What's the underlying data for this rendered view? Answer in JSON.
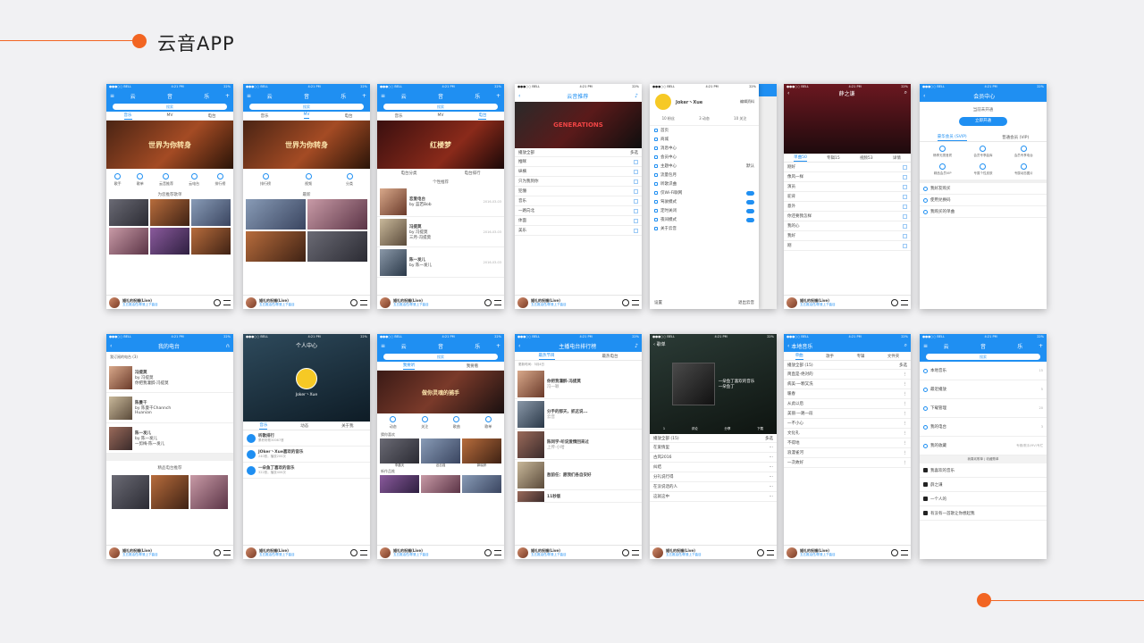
{
  "header": {
    "title": "云音APP"
  },
  "common": {
    "status": {
      "carrier": "●●●○○ BELL",
      "time": "4:21 PM",
      "battery": "22%"
    },
    "player": {
      "song": "婚礼的祝福(Live)",
      "artist": "五五推活任/陈曼上下曲目"
    },
    "search_placeholder": "搜索",
    "nav_tabs": [
      "云",
      "音",
      "乐"
    ],
    "sub_tabs": [
      "音乐",
      "MV",
      "电台"
    ]
  },
  "row1": {
    "p1": {
      "banner": "世界为你转身",
      "icons": [
        "歌手",
        "歌单",
        "云音推荐",
        "云电台",
        "排行榜"
      ],
      "section": "为您推荐歌单"
    },
    "p2": {
      "banner": "世界为你转身",
      "icons": [
        "排行榜",
        "视频",
        "分类"
      ],
      "section": "最新"
    },
    "p3": {
      "banner": "红楼梦",
      "icons": [
        "电台分类",
        "电台排行"
      ],
      "section": "个性推荐",
      "items": [
        {
          "title": "恋爱电台",
          "sub": "by 蓝若Bob",
          "date": "2016-03-03"
        },
        {
          "title": "冯提莫",
          "sub": "by 冯提莫",
          "date": "2016-03-03"
        },
        {
          "title": "三月-冯提莫",
          "sub": "",
          "date": ""
        },
        {
          "title": "陈一发儿",
          "sub": "by 陈一发儿",
          "date": "2016-03-03"
        }
      ]
    },
    "p4": {
      "title": "云音推荐",
      "banner": "GENERATIONS",
      "play_all": "播放全部",
      "multi": "多选",
      "songs": [
        "推眯",
        "纵横",
        "只为我到你",
        "犯懵",
        "音乐",
        "一路向北",
        "体面",
        "美乐"
      ]
    },
    "p5": {
      "user": "Joker丶Xue",
      "edit": "编辑资料",
      "stats": [
        "10 粉丝",
        "3 动态",
        "10 关注"
      ],
      "menu": [
        "首页",
        "商城",
        "消息中心",
        "会员中心",
        "主题中心",
        "流量包月",
        "听歌识曲",
        "仅Wi-Fi联网",
        "驾驶模式",
        "定时关闭",
        "夜间模式",
        "关于云音"
      ],
      "footer_left": "设置",
      "footer_right": "退出云音",
      "theme_value": "默认"
    },
    "p6": {
      "title": "薛之谦",
      "tabs": [
        "单曲50",
        "专辑15",
        "视频53",
        "详情"
      ],
      "songs": [
        "刚好",
        "像风一样",
        "演员",
        "驼背",
        "意外",
        "你还要我怎样",
        "我的心",
        "我好",
        "刚"
      ]
    },
    "p7": {
      "title": "会员中心",
      "status": "当前未开通",
      "button": "立即开通",
      "tabs": [
        "豪华会员 (SVIP)",
        "普通会员 (VIP)"
      ],
      "perks": [
        "畅享无损音质",
        "会员专享曲库",
        "会员专享电台",
        "精品会员VIP",
        "专属个性皮肤",
        "专属动态图片"
      ],
      "links": [
        "我好友购买",
        "使用兑换码",
        "我购买的单曲"
      ]
    }
  },
  "row2": {
    "q1": {
      "title": "我的电台",
      "sub": "我订阅的电台 (3)",
      "items": [
        {
          "title": "冯提莫",
          "sub": "by 冯提莫",
          "sub2": "你把我灌醉-冯提莫"
        },
        {
          "title": "陈曼千",
          "sub": "by 陈曼千Channch",
          "sub2": "Huanian"
        },
        {
          "title": "陈一发儿",
          "sub": "by 陈一发儿",
          "sub2": "一剪梅-陈一发儿"
        }
      ],
      "section": "精品电台推荐"
    },
    "q2": {
      "title": "个人中心",
      "user": "Joker丶Xue",
      "tabs": [
        "音乐",
        "动态",
        "关于我"
      ],
      "items": [
        {
          "title": "听歌排行",
          "sub": "累积听歌30067首"
        },
        {
          "title": "JOker丶Xue喜欢的音乐",
          "sub": "240首，播放200次"
        },
        {
          "title": "一朵鱼丁喜欢的音乐",
          "sub": "322首，播放40K次"
        }
      ]
    },
    "q3": {
      "tabs": [
        "我要听",
        "我要看"
      ],
      "banner": "做你灵魂的捕手",
      "icons": [
        "动态",
        "关注",
        "歌曲",
        "歌单"
      ],
      "section1": "猜你喜欢",
      "labels": [
        "李晨天",
        "迟志强",
        "郭晓婷"
      ],
      "section2": "新作品推"
    },
    "q4": {
      "title": "主播电台排行榜",
      "tabs": [
        "最热节目",
        "最热电台"
      ],
      "date": "更新时间：3月4日",
      "items": [
        {
          "title": "你把我灌醉-冯提莫",
          "sub": "冯一颖"
        },
        {
          "title": "分手的那天，抓这说...",
          "sub": "云音"
        },
        {
          "title": "陈同学-听说爱情回来过",
          "sub": "上传-小哈"
        },
        {
          "title": "敖前任：愿我们各自安好",
          "sub": ""
        },
        {
          "title": "11秒版",
          "sub": ""
        }
      ]
    },
    "q5": {
      "back": "歌单",
      "title": "一朵鱼丁喜欢的音乐",
      "owner": "一朵鱼丁",
      "actions": [
        "1",
        "评论",
        "分享",
        "下载"
      ],
      "play_all": "播放全部 (15)",
      "multi": "多选",
      "songs": [
        "在爱情里",
        "古风2016",
        "纠结",
        "分礼说行得",
        "在没说话的人",
        "这就这中"
      ]
    },
    "q6": {
      "title": "本地音乐",
      "tabs": [
        "单曲",
        "歌手",
        "专辑",
        "文件夹"
      ],
      "play_all": "播放全部 (15)",
      "multi": "多选",
      "songs": [
        "简直是-绝对的",
        "病美-一颗又洗",
        "暖春",
        "从此以后",
        "美丽-一路一段",
        "一不小心",
        "文化礼",
        "不得地",
        "浪漫雀河",
        "一次故好"
      ]
    },
    "q7": {
      "menu": [
        {
          "label": "本地音乐",
          "count": "15"
        },
        {
          "label": "最近播放",
          "count": "5"
        },
        {
          "label": "下载管理",
          "count": "20"
        },
        {
          "label": "我的电台",
          "count": "3"
        },
        {
          "label": "我的收藏",
          "count": "专辑/歌手/MV/专栏"
        }
      ],
      "section": "我喜欢歌单  |  收藏歌单",
      "items": [
        "我喜欢的音乐",
        "薛之谦",
        "一个人的",
        "有没有一首歌让你想起我"
      ]
    }
  }
}
